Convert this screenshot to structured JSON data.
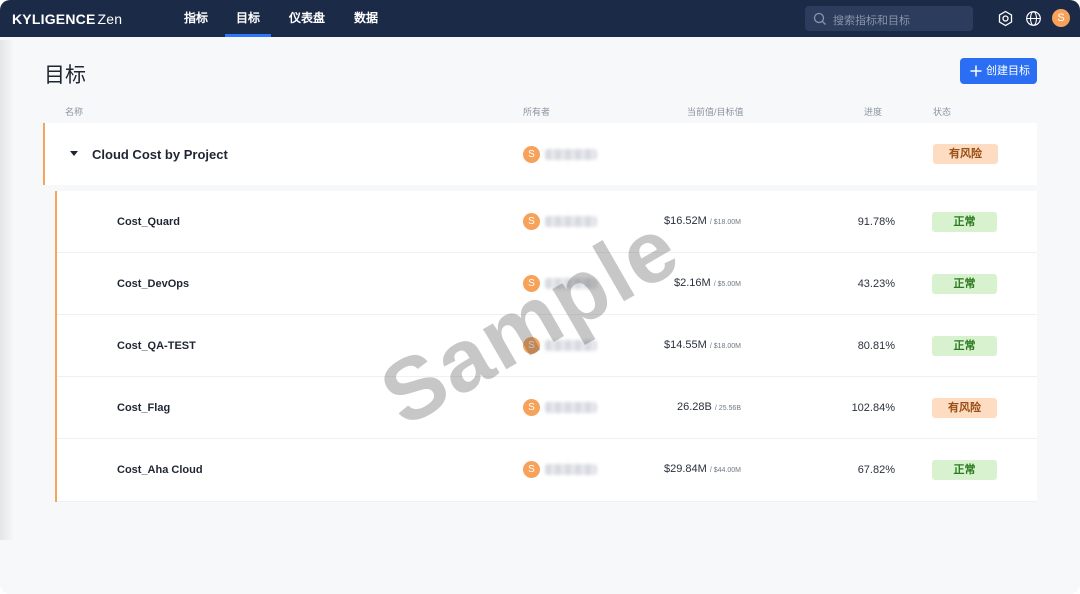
{
  "brand": {
    "name": "KYLIGENCE",
    "product": "Zen"
  },
  "nav": [
    {
      "label": "指标",
      "active": false
    },
    {
      "label": "目标",
      "active": true
    },
    {
      "label": "仪表盘",
      "active": false
    },
    {
      "label": "数据",
      "active": false
    }
  ],
  "search": {
    "placeholder": "搜索指标和目标"
  },
  "user": {
    "initial": "S"
  },
  "page": {
    "title": "目标",
    "create_label": "创建目标"
  },
  "columns": {
    "name": "名称",
    "owner": "所有者",
    "value": "当前值/目标值",
    "progress": "进度",
    "status": "状态"
  },
  "group": {
    "name": "Cloud Cost by Project",
    "owner_initial": "S",
    "status": "有风险",
    "status_type": "risk"
  },
  "rows": [
    {
      "name": "Cost_Quard",
      "owner_initial": "S",
      "current": "$16.52M",
      "target": "/ $18.00M",
      "progress": "91.78%",
      "status": "正常",
      "status_type": "ok"
    },
    {
      "name": "Cost_DevOps",
      "owner_initial": "S",
      "current": "$2.16M",
      "target": "/ $5.00M",
      "progress": "43.23%",
      "status": "正常",
      "status_type": "ok"
    },
    {
      "name": "Cost_QA-TEST",
      "owner_initial": "S",
      "current": "$14.55M",
      "target": "/ $18.00M",
      "progress": "80.81%",
      "status": "正常",
      "status_type": "ok"
    },
    {
      "name": "Cost_Flag",
      "owner_initial": "S",
      "current": "26.28B",
      "target": "/ 25.56B",
      "progress": "102.84%",
      "status": "有风险",
      "status_type": "risk"
    },
    {
      "name": "Cost_Aha Cloud",
      "owner_initial": "S",
      "current": "$29.84M",
      "target": "/ $44.00M",
      "progress": "67.82%",
      "status": "正常",
      "status_type": "ok"
    }
  ],
  "watermark": "Sample",
  "colors": {
    "nav_bg": "#1b2a47",
    "accent": "#2a6ff3",
    "risk_bg": "#fddcc2",
    "ok_bg": "#d8f2cf",
    "group_line": "#f3a65e"
  }
}
